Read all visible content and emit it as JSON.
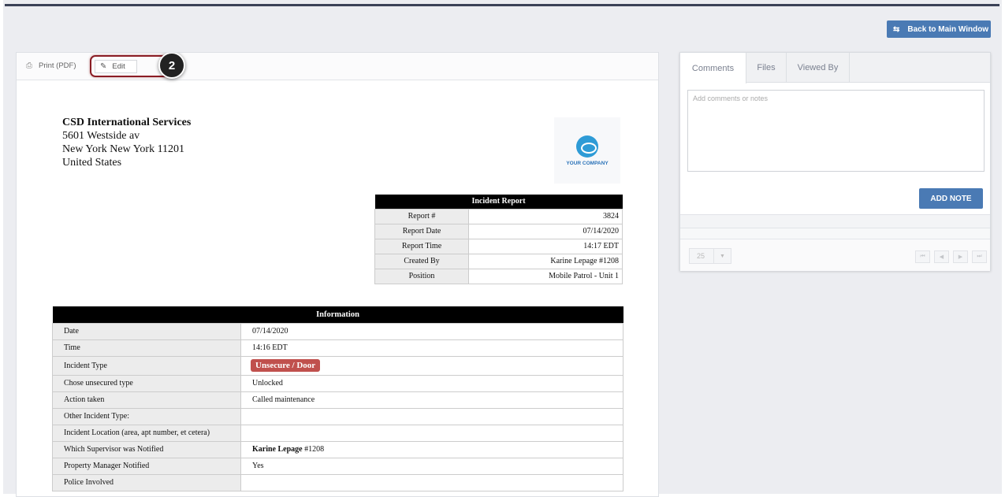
{
  "header": {
    "back_label": "Back to Main Window"
  },
  "toolbar": {
    "print_label": "Print (PDF)",
    "edit_label": "Edit",
    "step_number": "2"
  },
  "company": {
    "name": "CSD International Services",
    "address1": "5601 Westside av",
    "address2": "New York New York 11201",
    "country": "United States",
    "logo_text": "YOUR COMPANY"
  },
  "report": {
    "title": "Incident Report",
    "rows": [
      {
        "label": "Report #",
        "value": "3824"
      },
      {
        "label": "Report Date",
        "value": "07/14/2020"
      },
      {
        "label": "Report Time",
        "value": "14:17 EDT"
      },
      {
        "label": "Created By",
        "value": "Karine Lepage #1208"
      },
      {
        "label": "Position",
        "value": "Mobile Patrol - Unit 1"
      }
    ]
  },
  "info": {
    "title": "Information",
    "rows": [
      {
        "label": "Date",
        "value": "07/14/2020"
      },
      {
        "label": "Time",
        "value": "14:16 EDT"
      },
      {
        "label": "Incident Type",
        "value": "Unsecure / Door"
      },
      {
        "label": "Chose unsecured type",
        "value": "Unlocked"
      },
      {
        "label": "Action taken",
        "value": "Called maintenance"
      },
      {
        "label": "Other Incident Type:",
        "value": ""
      },
      {
        "label": "Incident Location (area, apt number, et cetera)",
        "value": ""
      },
      {
        "label": "Which Supervisor was Notified",
        "value_bold": "Karine Lepage",
        "value": " #1208"
      },
      {
        "label": "Property Manager Notified",
        "value": "Yes"
      },
      {
        "label": "Police Involved",
        "value": ""
      }
    ]
  },
  "side": {
    "tabs": [
      "Comments",
      "Files",
      "Viewed By"
    ],
    "comment_placeholder": "Add comments or notes",
    "add_note_label": "ADD NOTE",
    "page_size": "25"
  },
  "colors": {
    "accent": "#4a7ab4",
    "tag": "#c0504d",
    "highlight": "#8a1c24"
  }
}
